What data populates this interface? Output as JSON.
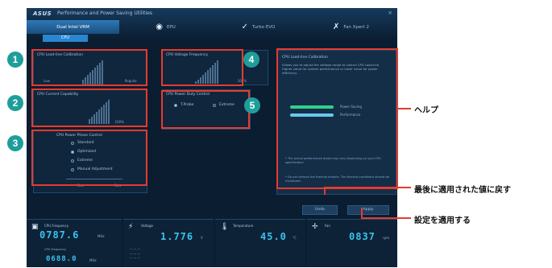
{
  "app": {
    "logo": "ASUS",
    "title": "Performance and Power Saving Utilities",
    "close": "×",
    "tabs": [
      {
        "label": "Dual Intel VRM",
        "icon": "▮"
      },
      {
        "label": "EPU",
        "icon": "◉"
      },
      {
        "label": "Turbo EVO",
        "icon": "✓"
      },
      {
        "label": "Fan Xpert 2",
        "icon": "✗"
      }
    ],
    "subtab": "CPU"
  },
  "panels": {
    "load_line": {
      "title": "CPU Load-line Calibration",
      "low": "Low",
      "high": "Regular"
    },
    "current_cap": {
      "title": "CPU Current Capability",
      "value": "100%"
    },
    "power_phase": {
      "title": "CPU Power Phase Control",
      "options": [
        {
          "label": "Standard",
          "selected": false
        },
        {
          "label": "Optimized",
          "selected": true
        },
        {
          "label": "Extreme",
          "selected": false
        },
        {
          "label": "Manual Adjustment",
          "selected": false
        }
      ],
      "fast": "Fast",
      "fast_right": "Fast"
    },
    "vrm_freq": {
      "title": "CPU Voltage Frequency",
      "value": "100%"
    },
    "duty": {
      "title": "CPU Power Duty Control",
      "opt1": "T.Probe",
      "opt2": "Extreme"
    }
  },
  "help": {
    "title": "CPU Load-line Calibration",
    "text": "Allows you to adjust the voltage range to control CPU Load-line. Higher value for system performance or lower value for power efficiency.",
    "bar1": "Power Saving",
    "bar2": "Performance",
    "note1": "* The actual performance boost may vary depending on your CPU specification.",
    "note2": "* Do not remove the thermal module. The thermal conditions should be monitored."
  },
  "buttons": {
    "undo": "Undo",
    "apply": "Apply"
  },
  "status": {
    "cpu": {
      "label": "CPU Frequency",
      "value": "0787.6",
      "unit": "MHz",
      "sub": "CPU Frequency",
      "sub_value": "0688.0",
      "sub_unit": "MHz"
    },
    "voltage": {
      "label": "Voltage",
      "value": "1.776",
      "unit": "V"
    },
    "temperature": {
      "label": "Temperature",
      "value": "45.0",
      "unit": "°C"
    },
    "fan": {
      "label": "Fan",
      "value": "0837",
      "unit": "rpm"
    }
  },
  "annotations": {
    "b1": "1",
    "b2": "2",
    "b3": "3",
    "b4": "4",
    "b5": "5",
    "help": "ヘルプ",
    "undo": "最後に適用された値に戻す",
    "apply": "設定を適用する"
  },
  "colors": {
    "accent": "#39c3ef",
    "annotation_red": "#e63b2e",
    "badge_teal": "#1e9e9a"
  }
}
